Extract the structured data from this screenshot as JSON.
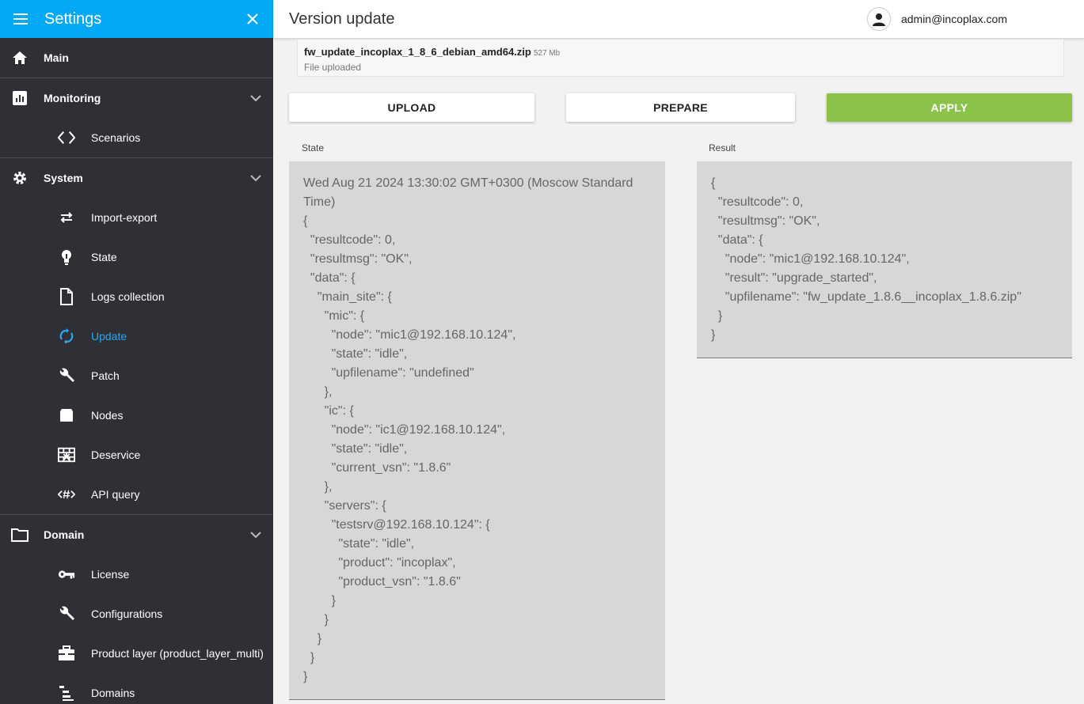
{
  "sidebar": {
    "title": "Settings",
    "sections": [
      {
        "label": "Main",
        "icon": "home-icon"
      },
      {
        "label": "Monitoring",
        "icon": "bar-chart-icon",
        "children": [
          {
            "label": "Scenarios",
            "icon": "code-brackets-icon"
          }
        ]
      },
      {
        "label": "System",
        "icon": "gear-icon",
        "children": [
          {
            "label": "Import-export",
            "icon": "swap-icon"
          },
          {
            "label": "State",
            "icon": "lightbulb-icon"
          },
          {
            "label": "Logs collection",
            "icon": "document-icon"
          },
          {
            "label": "Update",
            "icon": "sync-icon",
            "active": true
          },
          {
            "label": "Patch",
            "icon": "wrench-icon"
          },
          {
            "label": "Nodes",
            "icon": "card-icon"
          },
          {
            "label": "Deservice",
            "icon": "brick-wall-icon"
          },
          {
            "label": "API query",
            "icon": "api-code-icon"
          }
        ]
      },
      {
        "label": "Domain",
        "icon": "folder-icon",
        "children": [
          {
            "label": "License",
            "icon": "key-icon"
          },
          {
            "label": "Configurations",
            "icon": "wrench-icon"
          },
          {
            "label": "Product layer (product_layer_multi)",
            "icon": "briefcase-icon"
          },
          {
            "label": "Domains",
            "icon": "tree-list-icon"
          }
        ]
      }
    ]
  },
  "header": {
    "title": "Version update",
    "user": "admin@incoplax.com"
  },
  "file": {
    "name": "fw_update_incoplax_1_8_6_debian_amd64.zip",
    "size": "527 Mb",
    "status": "File uploaded"
  },
  "buttons": {
    "upload": "UPLOAD",
    "prepare": "PREPARE",
    "apply": "APPLY"
  },
  "state_panel": {
    "label": "State",
    "lines": [
      "Wed Aug 21 2024 13:30:02 GMT+0300 (Moscow Standard",
      "Time)",
      "{",
      "  \"resultcode\": 0,",
      "  \"resultmsg\": \"OK\",",
      "  \"data\": {",
      "    \"main_site\": {",
      "      \"mic\": {",
      "        \"node\": \"mic1@192.168.10.124\",",
      "        \"state\": \"idle\",",
      "        \"upfilename\": \"undefined\"",
      "      },",
      "      \"ic\": {",
      "        \"node\": \"ic1@192.168.10.124\",",
      "        \"state\": \"idle\",",
      "        \"current_vsn\": \"1.8.6\"",
      "      },",
      "      \"servers\": {",
      "        \"testsrv@192.168.10.124\": {",
      "          \"state\": \"idle\",",
      "          \"product\": \"incoplax\",",
      "          \"product_vsn\": \"1.8.6\"",
      "        }",
      "      }",
      "    }",
      "  }",
      "}"
    ]
  },
  "result_panel": {
    "label": "Result",
    "lines": [
      "{",
      "  \"resultcode\": 0,",
      "  \"resultmsg\": \"OK\",",
      "  \"data\": {",
      "    \"node\": \"mic1@192.168.10.124\",",
      "    \"result\": \"upgrade_started\",",
      "    \"upfilename\": \"fw_update_1.8.6__incoplax_1.8.6.zip\"",
      "  }",
      "}"
    ]
  },
  "colors": {
    "sidebar_bg": "#2f3035",
    "header_bg": "#03a9f4",
    "active": "#29a8f0",
    "apply": "#8bc34a"
  }
}
